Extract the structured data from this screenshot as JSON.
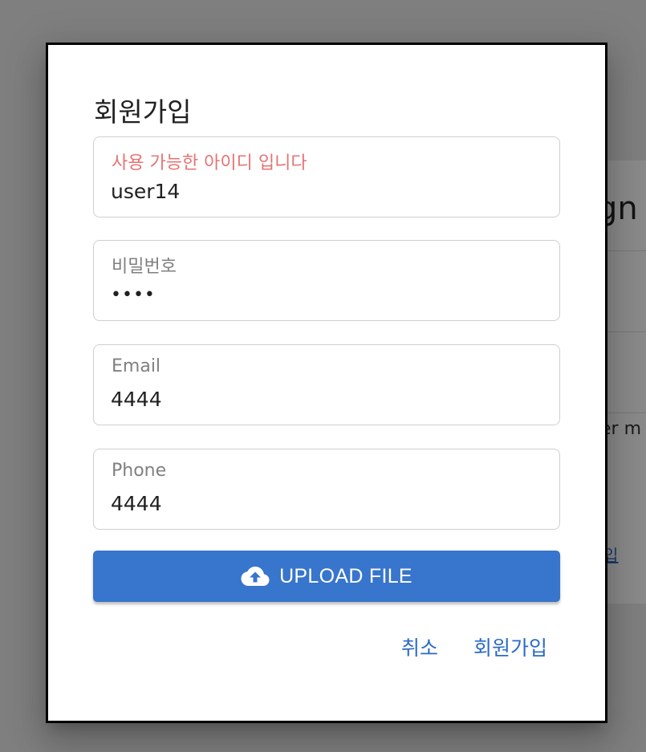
{
  "background": {
    "title_fragment": "gn",
    "text_fragment": "er m",
    "link_fragment": "입"
  },
  "dialog": {
    "title": "회원가입",
    "fields": [
      {
        "label": "사용 가능한 아이디 입니다",
        "value": "user14",
        "status": "success"
      },
      {
        "label": "비밀번호",
        "value": "••••",
        "type": "password"
      },
      {
        "label": "Email",
        "value": "4444"
      },
      {
        "label": "Phone",
        "value": "4444"
      }
    ],
    "upload": {
      "label": "UPLOAD FILE",
      "icon": "cloud-upload-icon"
    },
    "actions": {
      "cancel": "취소",
      "submit": "회원가입"
    }
  },
  "colors": {
    "primary": "#3875cc",
    "link": "#2c6bc4",
    "success_label": "#e57373",
    "overlay": "#7f7f7f"
  }
}
